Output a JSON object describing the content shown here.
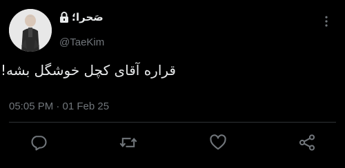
{
  "author": {
    "display_name": "صَحرا؛",
    "handle": "@TaeKim",
    "protected": true
  },
  "tweet": {
    "text": "قراره آقای کچل خوشگل بشه!",
    "timestamp": "05:05 PM · 01 Feb 25"
  },
  "actions": [
    "reply-icon",
    "retweet-icon",
    "like-icon",
    "share-icon"
  ],
  "colors": {
    "background": "#000000",
    "text": "#e7e9ea",
    "secondary": "#71767b",
    "divider": "#2f3336"
  }
}
